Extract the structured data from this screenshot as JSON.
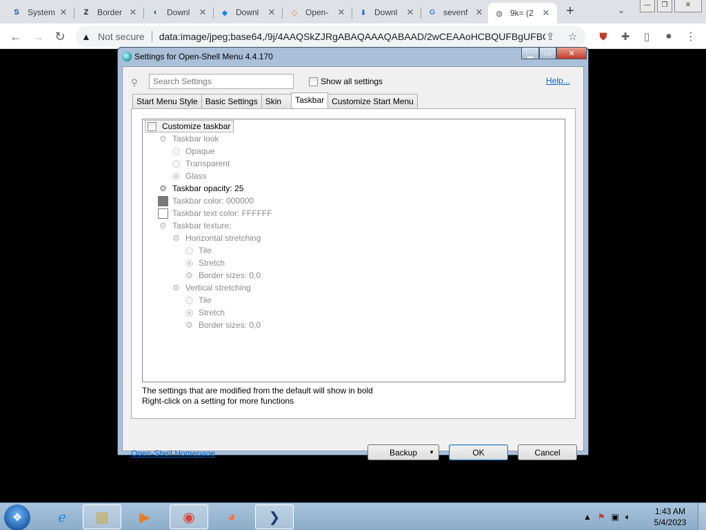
{
  "browser": {
    "tabs": [
      {
        "title": "System",
        "favicon": "S",
        "color": "#1a4fa0"
      },
      {
        "title": "Border",
        "favicon": "Z",
        "color": "#1a1a1a"
      },
      {
        "title": "Downl",
        "favicon": "◐",
        "color": "#2b4a7a"
      },
      {
        "title": "Downl",
        "favicon": "◆",
        "color": "#1e88e5"
      },
      {
        "title": "Open-",
        "favicon": "◇",
        "color": "#e67e22"
      },
      {
        "title": "Downl",
        "favicon": "⬇",
        "color": "#1e6fd9"
      },
      {
        "title": "sevenf",
        "favicon": "G",
        "color": "#4285f4"
      },
      {
        "title": "9k= (2",
        "favicon": "◍",
        "color": "#5f6368",
        "active": true
      }
    ],
    "security_label": "Not secure",
    "url": "data:image/jpeg;base64,/9j/4AAQSkZJRgABAQAAAQABAAD/2wCEAAoHCBQUFBgUFBQ..."
  },
  "dialog": {
    "title": "Settings for Open-Shell Menu 4.4.170",
    "search_placeholder": "Search Settings",
    "show_all_label": "Show all settings",
    "help_label": "Help...",
    "tabs": [
      "Start Menu Style",
      "Basic Settings",
      "Skin",
      "Taskbar",
      "Customize Start Menu"
    ],
    "active_tab": "Taskbar",
    "tree": [
      {
        "label": "Customize taskbar",
        "type": "checkbox",
        "indent": 0,
        "bold": true
      },
      {
        "label": "Taskbar look",
        "type": "gear",
        "indent": 1
      },
      {
        "label": "Opaque",
        "type": "radio",
        "indent": 2
      },
      {
        "label": "Transparent",
        "type": "radio",
        "indent": 2
      },
      {
        "label": "Glass",
        "type": "radio",
        "indent": 2,
        "selected": true
      },
      {
        "label": "Taskbar opacity: 25",
        "type": "gear",
        "indent": 1,
        "bold": true
      },
      {
        "label": "Taskbar color: 000000",
        "type": "swatch",
        "indent": 1,
        "swatch": "#7a7a7a"
      },
      {
        "label": "Taskbar text color: FFFFFF",
        "type": "swatch",
        "indent": 1,
        "swatch": "#ffffff"
      },
      {
        "label": "Taskbar texture:",
        "type": "gear",
        "indent": 1
      },
      {
        "label": "Horizontal stretching",
        "type": "gear",
        "indent": 2
      },
      {
        "label": "Tile",
        "type": "radio",
        "indent": 3
      },
      {
        "label": "Stretch",
        "type": "radio",
        "indent": 3,
        "selected": true
      },
      {
        "label": "Border sizes: 0,0",
        "type": "gear",
        "indent": 3
      },
      {
        "label": "Vertical stretching",
        "type": "gear",
        "indent": 2
      },
      {
        "label": "Tile",
        "type": "radio",
        "indent": 3
      },
      {
        "label": "Stretch",
        "type": "radio",
        "indent": 3,
        "selected": true
      },
      {
        "label": "Border sizes: 0,0",
        "type": "gear",
        "indent": 3
      }
    ],
    "footnote_line1": "The settings that are modified from the default will show in bold",
    "footnote_line2": "Right-click on a setting for more functions",
    "homepage_label": "Open-Shell Homepage",
    "backup_label": "Backup",
    "ok_label": "OK",
    "cancel_label": "Cancel"
  },
  "taskbar": {
    "time": "1:43 AM",
    "date": "5/4/2023"
  },
  "colors": {
    "dialog_frame": "#a9c0d8",
    "link": "#0066cc",
    "taskbar": "#8bacc9"
  }
}
